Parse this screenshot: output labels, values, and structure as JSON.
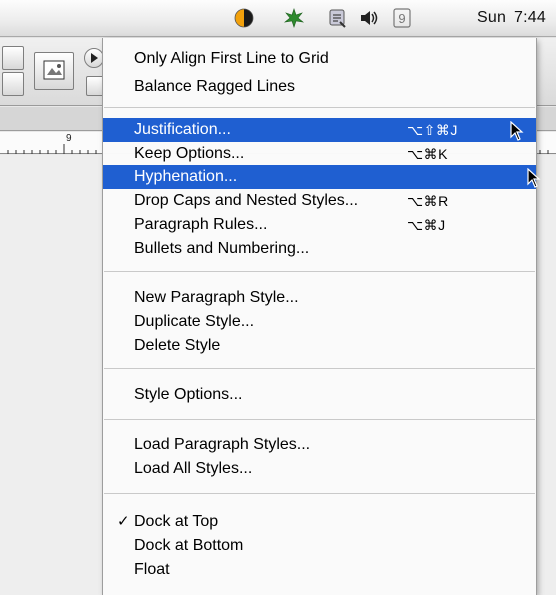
{
  "menubar": {
    "clock": {
      "day": "Sun",
      "time": "7:44"
    },
    "icons": [
      "colorsync-icon",
      "leaf-icon",
      "script-icon",
      "volume-icon",
      "clock-icon"
    ],
    "clock_icon_label": "9"
  },
  "ruler": {
    "label": "9"
  },
  "menu": {
    "items": [
      {
        "label": "Only Align First Line to Grid"
      },
      {
        "label": "Balance Ragged Lines"
      },
      {
        "label": "Justification...",
        "shortcut": "⌥⇧⌘J",
        "highlighted": true
      },
      {
        "label": "Keep Options...",
        "shortcut": "⌥⌘K"
      },
      {
        "label": "Hyphenation...",
        "highlighted": true
      },
      {
        "label": "Drop Caps and Nested Styles...",
        "shortcut": "⌥⌘R"
      },
      {
        "label": "Paragraph Rules...",
        "shortcut": "⌥⌘J"
      },
      {
        "label": "Bullets and Numbering..."
      },
      {
        "label": "New Paragraph Style..."
      },
      {
        "label": "Duplicate Style..."
      },
      {
        "label": "Delete Style"
      },
      {
        "label": "Style Options..."
      },
      {
        "label": "Load Paragraph Styles..."
      },
      {
        "label": "Load All Styles..."
      },
      {
        "label": "Dock at Top",
        "checked": true,
        "check": "✓"
      },
      {
        "label": "Dock at Bottom"
      },
      {
        "label": "Float"
      }
    ]
  },
  "colors": {
    "highlight": "#1f5fd1",
    "menu_bg": "#fafafa",
    "separator": "#c9c9c9"
  }
}
